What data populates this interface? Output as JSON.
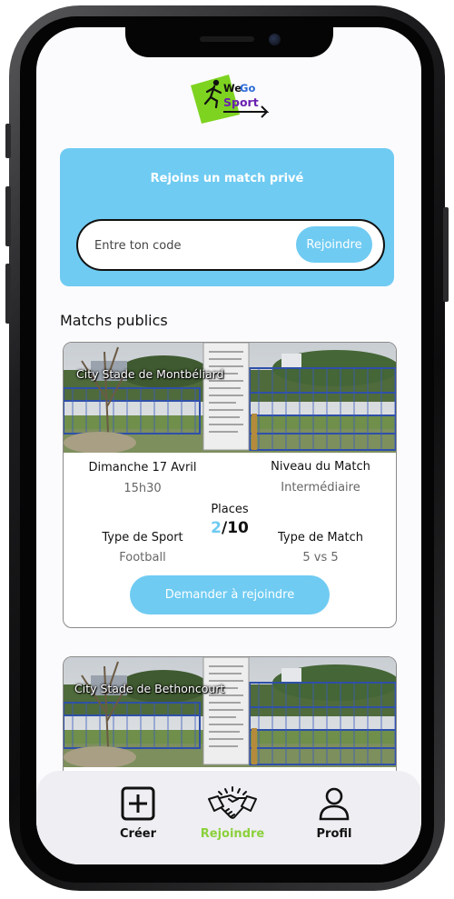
{
  "app": {
    "logo_text_1": "WeGo",
    "logo_text_2": "Sport",
    "logo_icon": "runner-icon"
  },
  "private_match": {
    "title": "Rejoins un match privé",
    "code_placeholder": "Entre ton code",
    "code_value": "",
    "join_label": "Rejoindre"
  },
  "public_matches": {
    "heading": "Matchs publics",
    "labels": {
      "sport_type": "Type de Sport",
      "match_type": "Type de Match",
      "level": "Niveau du Match",
      "places": "Places"
    },
    "items": [
      {
        "location": "City Stade de Montbéliard",
        "date": "Dimanche 17 Avril",
        "time": "15h30",
        "level": "Intermédiaire",
        "places_taken": "2",
        "places_total": "/10",
        "sport": "Football",
        "match_type": "5 vs 5",
        "request_label": "Demander à rejoindre"
      },
      {
        "location": "City Stade de Bethoncourt"
      }
    ]
  },
  "nav": {
    "items": [
      {
        "label": "Créer",
        "icon": "plus-square-icon",
        "active": false
      },
      {
        "label": "Rejoindre",
        "icon": "handshake-icon",
        "active": true
      },
      {
        "label": "Profil",
        "icon": "user-icon",
        "active": false
      }
    ]
  },
  "colors": {
    "accent": "#6fcbf2",
    "active_nav": "#8bd13b",
    "logo_green": "#7ed321",
    "logo_purple": "#6a1fb0"
  }
}
